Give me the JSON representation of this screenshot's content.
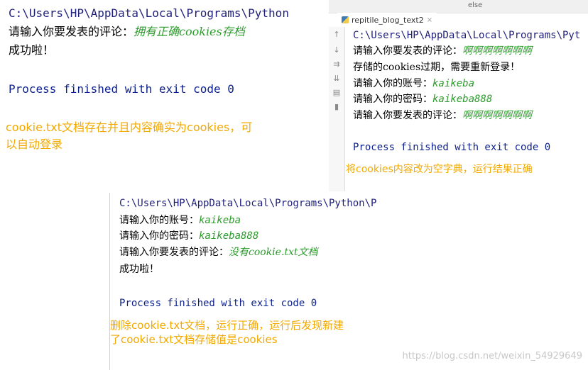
{
  "panel1": {
    "path": "C:\\Users\\HP\\AppData\\Local\\Programs\\Python",
    "prompt_label": "请输入你要发表的评论：",
    "prompt_value": "拥有正确cookies存档",
    "success": "成功啦！",
    "process": "Process finished with exit code 0",
    "note_line1": "cookie.txt文档存在并且内容确实为cookies，可",
    "note_line2": "以自动登录"
  },
  "panel2": {
    "top_label": "else",
    "tab_name": "repitile_blog_text2",
    "tab_close": "×",
    "path": "C:\\Users\\HP\\AppData\\Local\\Programs\\Pyt",
    "lines": [
      {
        "label": "请输入你要发表的评论：",
        "value": "啊啊啊啊啊啊啊"
      },
      {
        "label": "存储的cookies过期，需要重新登录！",
        "value": ""
      },
      {
        "label": "请输入你的账号：",
        "value": "kaikeba"
      },
      {
        "label": "请输入你的密码：",
        "value": "kaikeba888"
      },
      {
        "label": "请输入你要发表的评论：",
        "value": "啊啊啊啊啊啊啊"
      }
    ],
    "process": "Process finished with exit code 0",
    "note": "将cookies内容改为空字典，运行结果正确",
    "gutter_icons": [
      "arrow-up-icon",
      "arrow-down-icon",
      "wrap-icon",
      "scroll-end-icon",
      "print-icon",
      "trash-icon"
    ]
  },
  "panel3": {
    "path": "C:\\Users\\HP\\AppData\\Local\\Programs\\Python\\P",
    "lines": [
      {
        "label": "请输入你的账号：",
        "value": "kaikeba"
      },
      {
        "label": "请输入你的密码：",
        "value": "kaikeba888"
      },
      {
        "label": "请输入你要发表的评论：",
        "value": "没有cookie.txt文档"
      }
    ],
    "success": "成功啦！",
    "process": "Process finished with exit code 0",
    "note_line1": "删除cookie.txt文档，运行正确，运行后发现新建",
    "note_line2": "了cookie.txt文档存储值是cookies"
  },
  "watermark": "https://blog.csdn.net/weixin_54929649"
}
